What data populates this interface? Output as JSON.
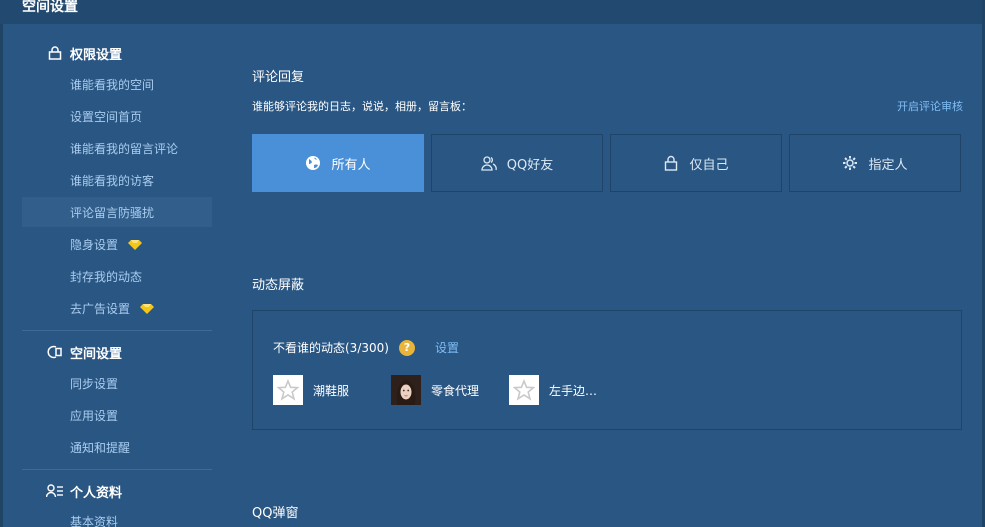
{
  "header": {
    "title": "空间设置"
  },
  "sidebar": {
    "sections": [
      {
        "title": "权限设置",
        "icon": "lock-icon",
        "items": [
          {
            "label": "谁能看我的空间"
          },
          {
            "label": "设置空间首页"
          },
          {
            "label": "谁能看我的留言评论"
          },
          {
            "label": "谁能看我的访客"
          },
          {
            "label": "评论留言防骚扰",
            "active": true
          },
          {
            "label": "隐身设置",
            "badge": "diamond-icon"
          },
          {
            "label": "封存我的动态"
          },
          {
            "label": "去广告设置",
            "badge": "diamond-icon"
          }
        ]
      },
      {
        "title": "空间设置",
        "icon": "space-settings-icon",
        "items": [
          {
            "label": "同步设置"
          },
          {
            "label": "应用设置"
          },
          {
            "label": "通知和提醒"
          }
        ]
      },
      {
        "title": "个人资料",
        "icon": "profile-icon",
        "items": [
          {
            "label": "基本资料"
          }
        ]
      }
    ]
  },
  "main": {
    "comment_reply": {
      "title": "评论回复",
      "description": "谁能够评论我的日志，说说，相册，留言板：",
      "audit_link": "开启评论审核",
      "options": [
        {
          "label": "所有人",
          "icon": "globe-icon",
          "selected": true
        },
        {
          "label": "QQ好友",
          "icon": "friends-icon",
          "selected": false
        },
        {
          "label": "仅自己",
          "icon": "lock-icon",
          "selected": false
        },
        {
          "label": "指定人",
          "icon": "gear-icon",
          "selected": false
        }
      ]
    },
    "feed_block": {
      "title": "动态屏蔽",
      "label": "不看谁的动态(3/300)",
      "help": "?",
      "settings_link": "设置",
      "users": [
        {
          "name": "潮鞋服",
          "avatar": "default-star-avatar"
        },
        {
          "name": "零食代理",
          "avatar": "photo-avatar"
        },
        {
          "name": "左手边…",
          "avatar": "default-star-avatar"
        }
      ]
    },
    "qq_popup": {
      "title": "QQ弹窗"
    }
  },
  "colors": {
    "background": "#2a5683",
    "selected": "#4a90d9",
    "link": "#7fbdf6",
    "diamond": "#f5c518"
  }
}
